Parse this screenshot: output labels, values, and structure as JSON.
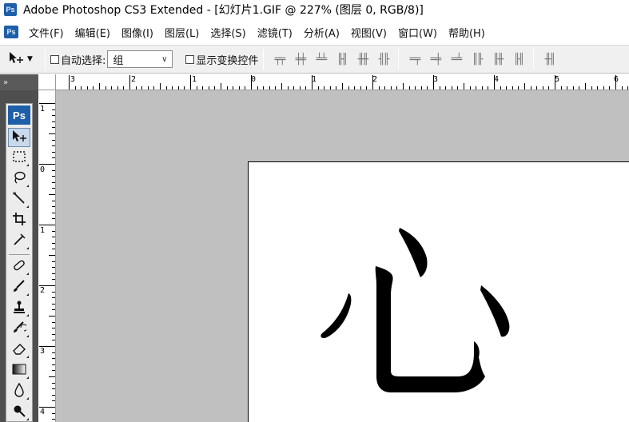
{
  "window": {
    "app_icon": "Ps",
    "title": "Adobe Photoshop CS3 Extended - [幻灯片1.GIF @ 227% (图层 0, RGB/8)]"
  },
  "menu": {
    "icon": "Ps",
    "items": [
      "文件(F)",
      "编辑(E)",
      "图像(I)",
      "图层(L)",
      "选择(S)",
      "滤镜(T)",
      "分析(A)",
      "视图(V)",
      "窗口(W)",
      "帮助(H)"
    ]
  },
  "options": {
    "auto_select_label": "自动选择:",
    "auto_select_value": "组",
    "show_transform_label": "显示变换控件",
    "tool_preset_icon": "move-tool-icon"
  },
  "toolbox": {
    "collapse_label": "»",
    "badge": "Ps",
    "tools": [
      "move-tool",
      "marquee-tool",
      "lasso-tool",
      "magic-wand-tool",
      "crop-tool",
      "slice-tool",
      "healing-brush-tool",
      "brush-tool",
      "clone-stamp-tool",
      "history-brush-tool",
      "eraser-tool",
      "gradient-tool",
      "blur-tool",
      "dodge-tool"
    ]
  },
  "rulers": {
    "top_labels": [
      "3",
      "2",
      "1",
      "0",
      "1",
      "2",
      "3",
      "4",
      "5",
      "6"
    ],
    "left_labels": [
      "1",
      "0",
      "1",
      "2",
      "3",
      "4"
    ]
  },
  "document": {
    "content_glyph": "心",
    "background_color": "#ffffff",
    "workspace_color": "#c0c0c0"
  },
  "colors": {
    "accent": "#1e5fa8",
    "toolbox_bg": "#4f4f4f"
  }
}
